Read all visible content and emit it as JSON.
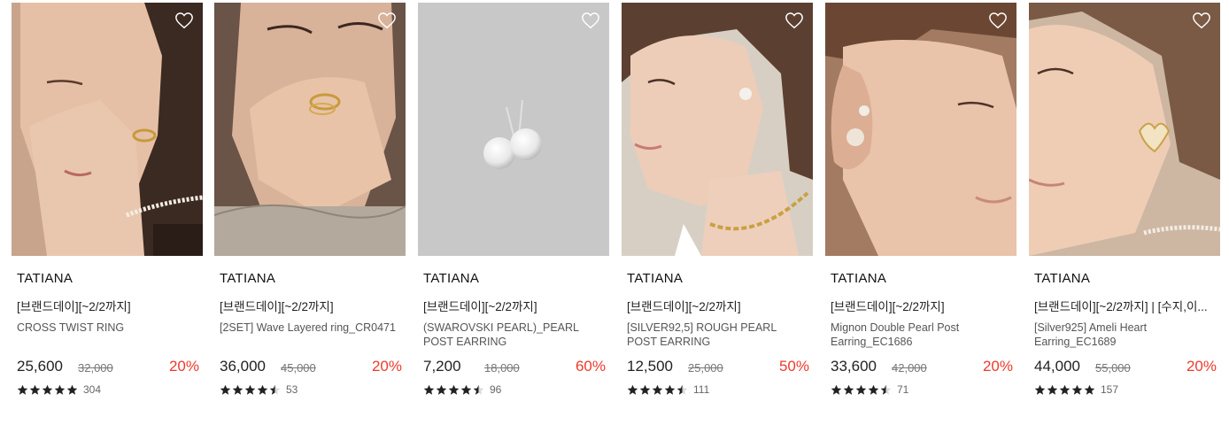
{
  "products": [
    {
      "brand": "TATIANA",
      "promo": "[브랜드데이][~2/2까지]",
      "name": "CROSS TWIST RING",
      "price": "25,600",
      "original_price": "32,000",
      "discount": "20%",
      "rating_stars": 5,
      "review_count": "304",
      "image": "model-hand-cheek-gold-ring"
    },
    {
      "brand": "TATIANA",
      "promo": "[브랜드데이][~2/2까지]",
      "name": "[2SET] Wave Layered ring_CR0471",
      "price": "36,000",
      "original_price": "45,000",
      "discount": "20%",
      "rating_stars": 4.5,
      "review_count": "53",
      "image": "model-hand-mouth-layered-ring"
    },
    {
      "brand": "TATIANA",
      "promo": "[브랜드데이][~2/2까지]",
      "name": "(SWAROVSKI PEARL)_PEARL POST EARRING",
      "price": "7,200",
      "original_price": "18,000",
      "discount": "60%",
      "rating_stars": 4.5,
      "review_count": "96",
      "image": "pearl-stud-earrings-grey-background"
    },
    {
      "brand": "TATIANA",
      "promo": "[브랜드데이][~2/2까지]",
      "name": "[SILVER92,5] ROUGH PEARL POST EARRING",
      "price": "12,500",
      "original_price": "25,000",
      "discount": "50%",
      "rating_stars": 4.5,
      "review_count": "111",
      "image": "model-profile-pearl-earring-chain"
    },
    {
      "brand": "TATIANA",
      "promo": "[브랜드데이][~2/2까지]",
      "name": "Mignon Double Pearl Post Earring_EC1686",
      "price": "33,600",
      "original_price": "42,000",
      "discount": "20%",
      "rating_stars": 4.5,
      "review_count": "71",
      "image": "model-ear-double-pearl"
    },
    {
      "brand": "TATIANA",
      "promo": "[브랜드데이][~2/2까지] | [수지,이...",
      "name": "[Silver925] Ameli Heart Earring_EC1689",
      "price": "44,000",
      "original_price": "55,000",
      "discount": "20%",
      "rating_stars": 5,
      "review_count": "157",
      "image": "model-ear-heart-earring"
    }
  ],
  "colors": {
    "discount": "#ee3a2b",
    "star": "#222222"
  },
  "icons": {
    "wishlist": "heart-outline-icon",
    "rating": "star-icon"
  }
}
